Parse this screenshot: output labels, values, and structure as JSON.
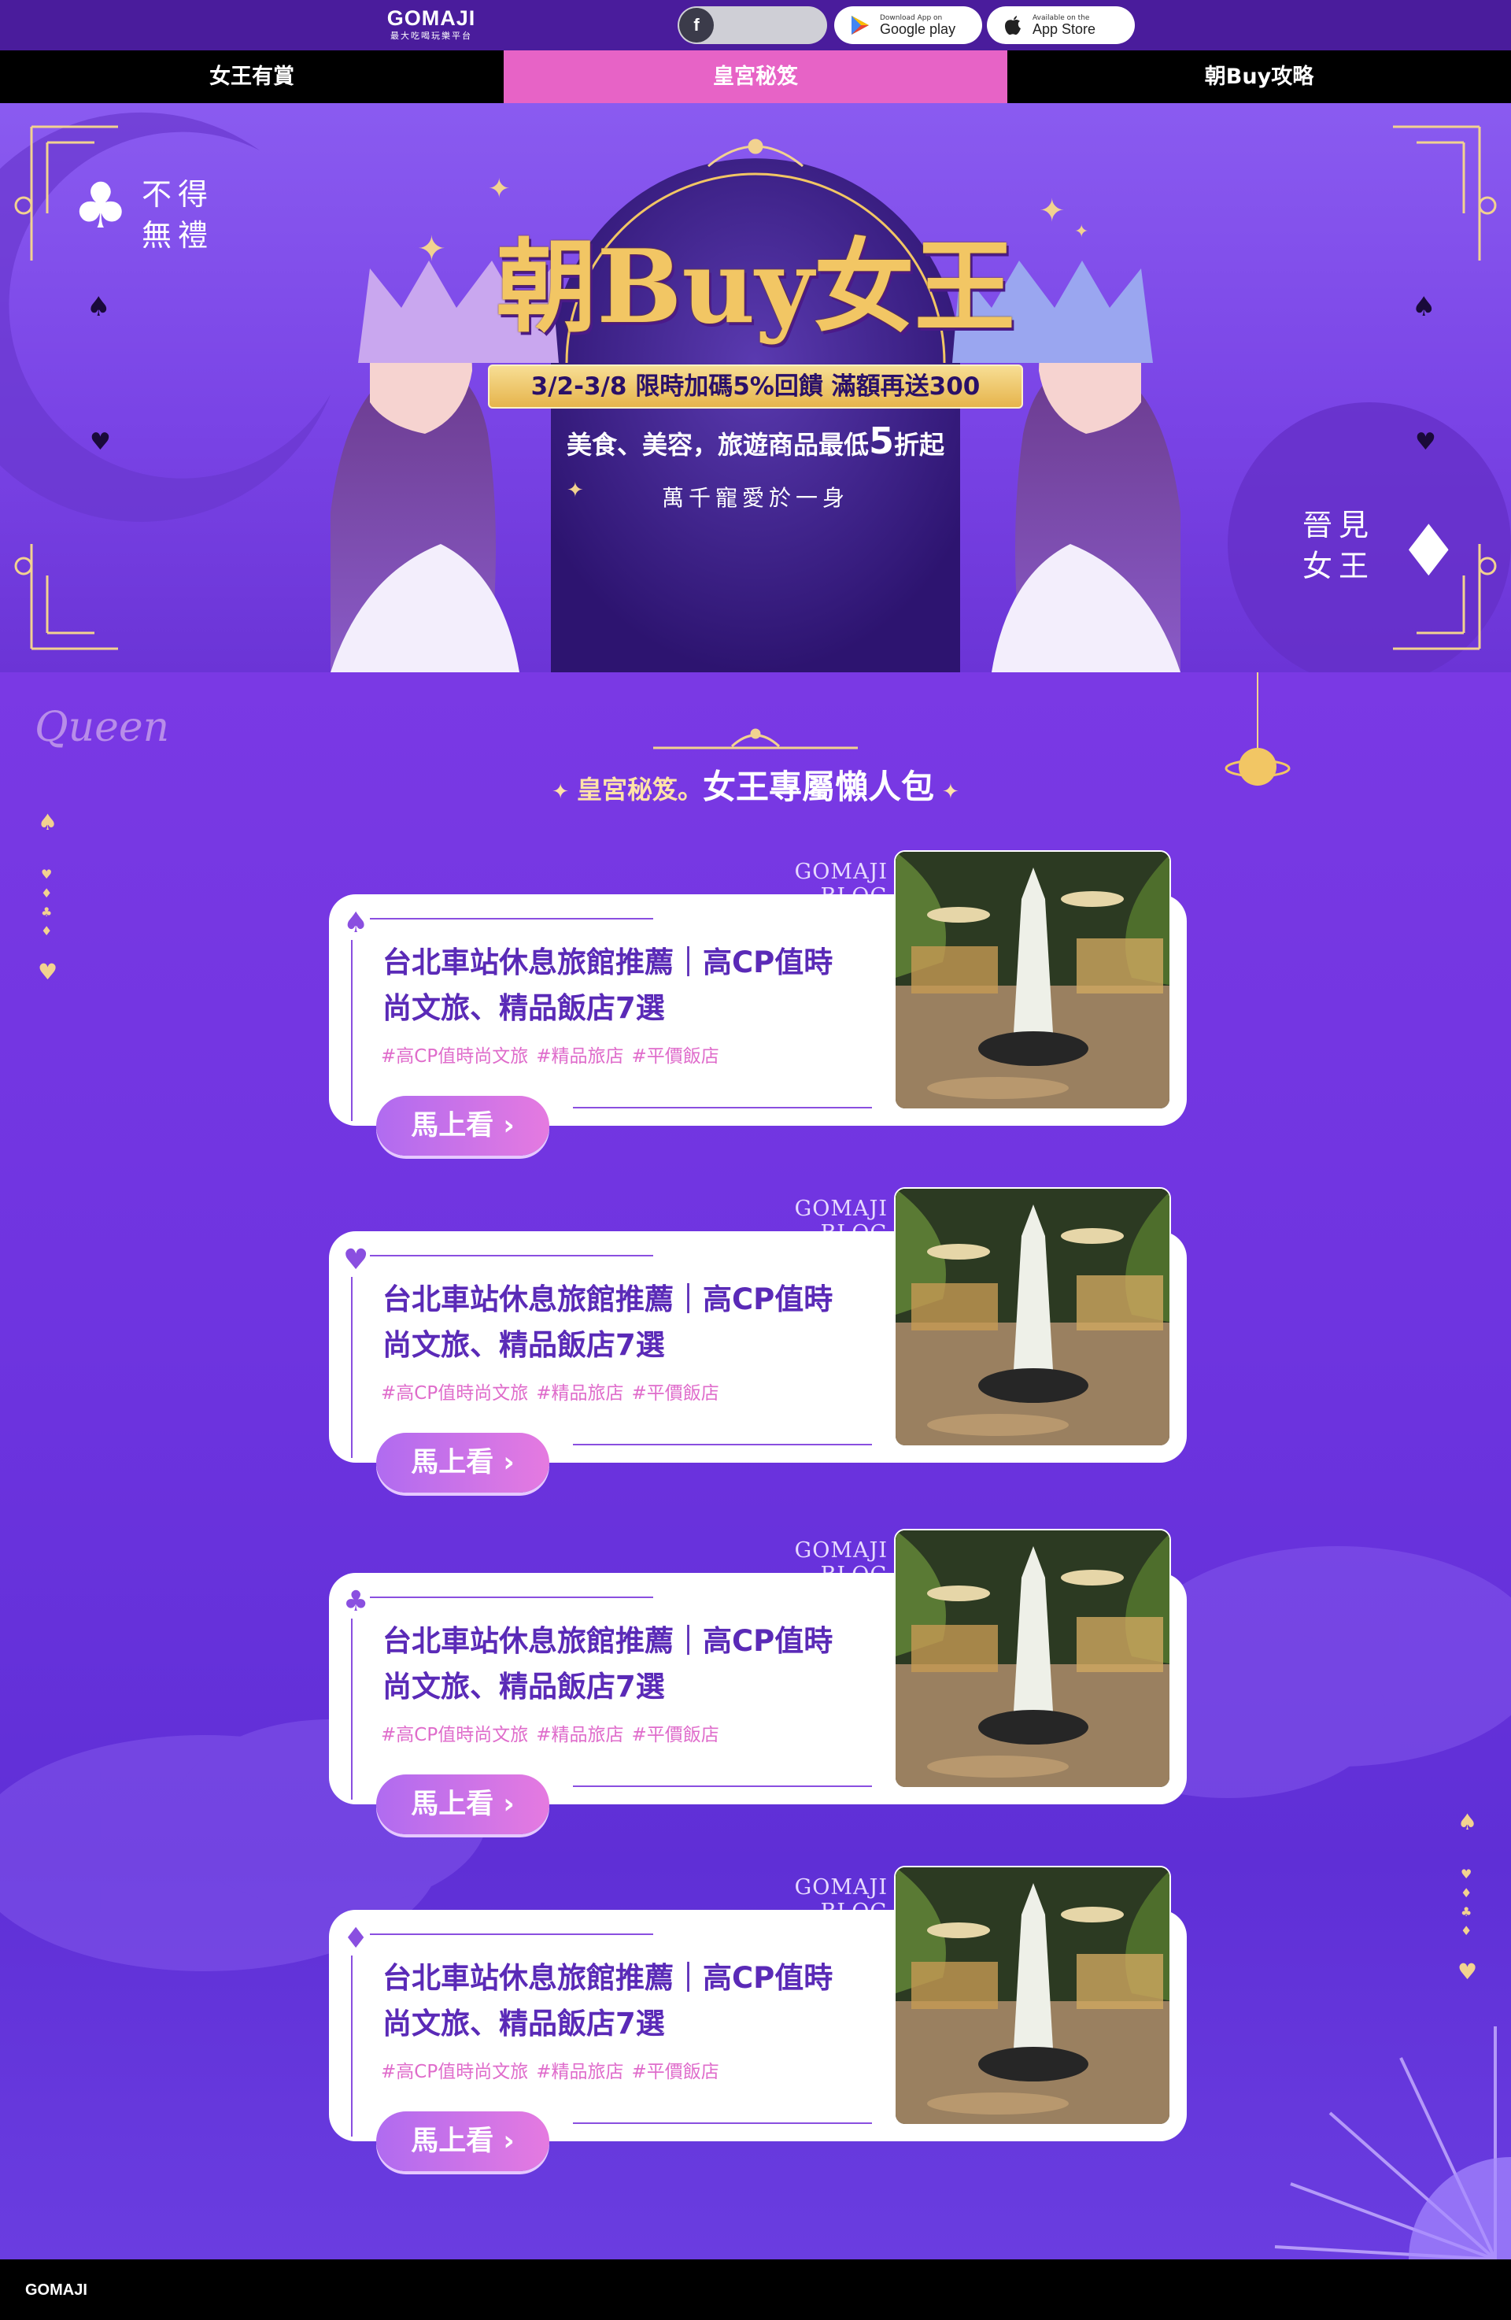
{
  "header": {
    "brand": "GOMAJI",
    "tagline": "最大吃喝玩樂平台",
    "fb_label": "f",
    "google_play": {
      "small": "Download App on",
      "big": "Google play"
    },
    "app_store": {
      "small": "Available on the",
      "big": "App Store"
    }
  },
  "tabs": [
    {
      "label": "女王有賞",
      "active": false
    },
    {
      "label": "皇宮秘笈",
      "active": true
    },
    {
      "label": "朝Buy攻略",
      "active": false
    }
  ],
  "hero": {
    "left_vertical": "不得\n無禮",
    "right_vertical": "晉見\n女王",
    "title": "朝Buy女王",
    "promo": "3/2-3/8 限時加碼5%回饋 滿額再送300",
    "sub_prefix": "美食、美容，旅遊商品最低",
    "sub_big": "5",
    "sub_suffix": "折起",
    "motto": "萬千寵愛於一身"
  },
  "section": {
    "queen": "Queen",
    "title_prefix": "皇宮秘笈。",
    "title_main": "女王專屬懶人包"
  },
  "cards": [
    {
      "suit": "♠",
      "blog": "GOMAJI BLOG",
      "title": "台北車站休息旅館推薦｜高CP值時尚文旅、精品飯店7選",
      "tags": [
        "#高CP值時尚文旅",
        "#精品旅店",
        "#平價飯店"
      ],
      "button": "馬上看 ›"
    },
    {
      "suit": "♥",
      "blog": "GOMAJI BLOG",
      "title": "台北車站休息旅館推薦｜高CP值時尚文旅、精品飯店7選",
      "tags": [
        "#高CP值時尚文旅",
        "#精品旅店",
        "#平價飯店"
      ],
      "button": "馬上看 ›"
    },
    {
      "suit": "♣",
      "blog": "GOMAJI BLOG",
      "title": "台北車站休息旅館推薦｜高CP值時尚文旅、精品飯店7選",
      "tags": [
        "#高CP值時尚文旅",
        "#精品旅店",
        "#平價飯店"
      ],
      "button": "馬上看 ›"
    },
    {
      "suit": "♦",
      "blog": "GOMAJI BLOG",
      "title": "台北車站休息旅館推薦｜高CP值時尚文旅、精品飯店7選",
      "tags": [
        "#高CP值時尚文旅",
        "#精品旅店",
        "#平價飯店"
      ],
      "button": "馬上看 ›"
    }
  ],
  "footer": {
    "brand": "GOMAJI"
  },
  "colors": {
    "accent_pink": "#e763c6",
    "purple": "#6d36e0",
    "gold": "#f2c664",
    "title_purple": "#5a2ab7",
    "tag_pink": "#df6ccb"
  }
}
